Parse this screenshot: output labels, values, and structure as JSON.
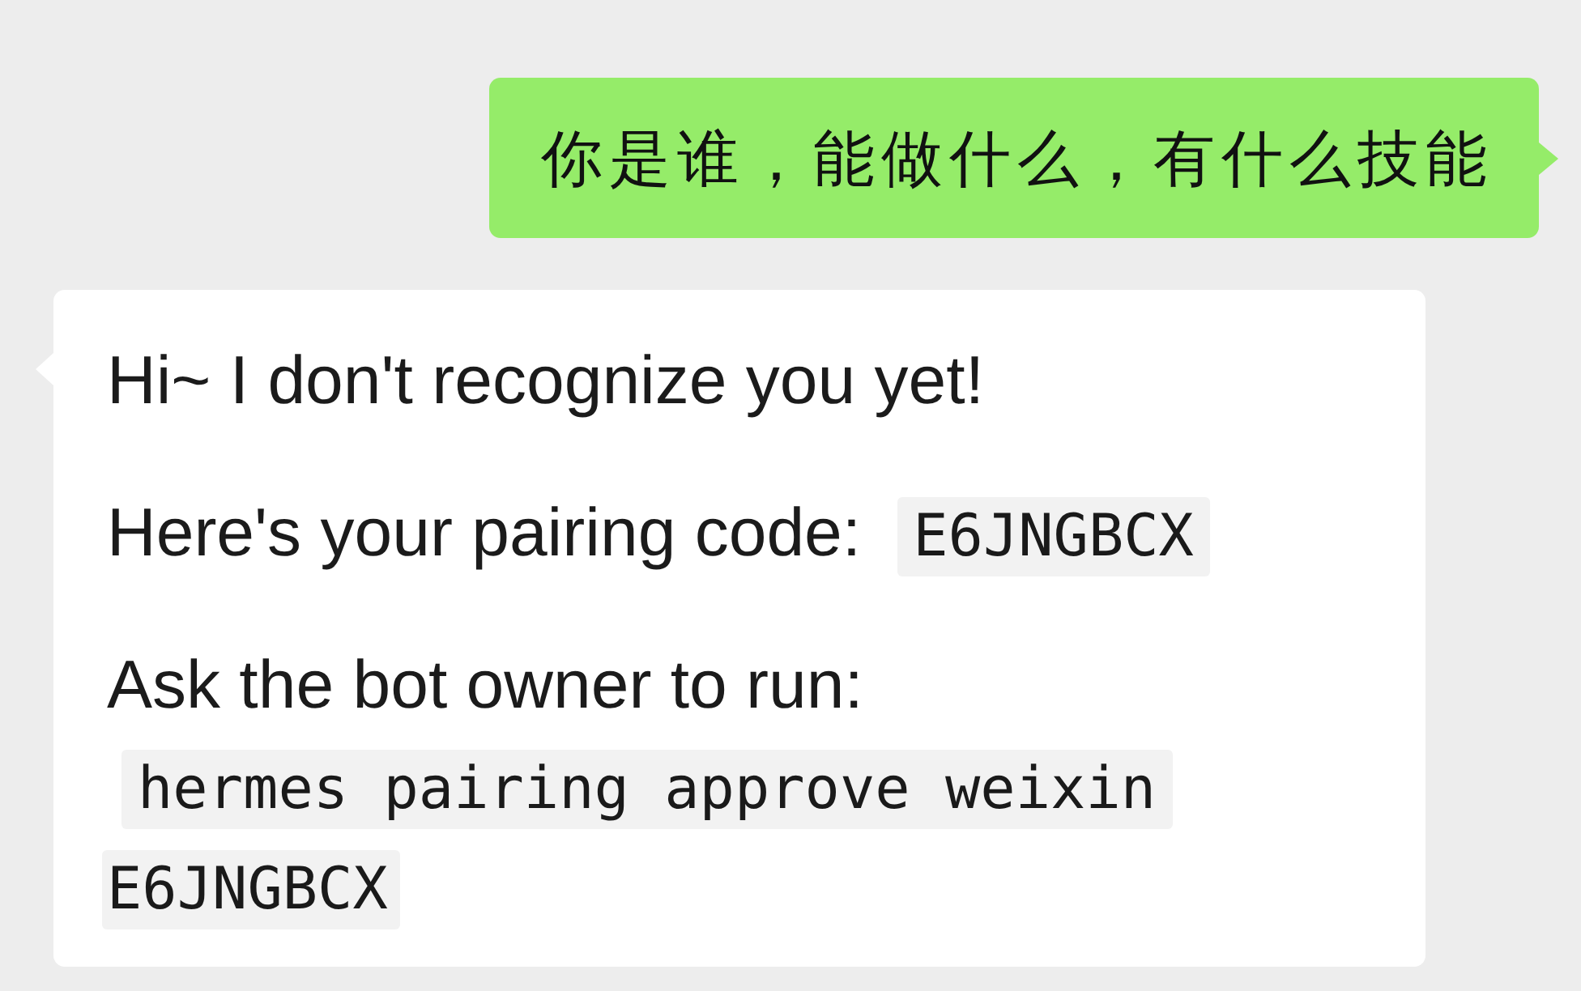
{
  "messages": [
    {
      "kind": "sent",
      "text": "你是谁，能做什么，有什么技能"
    },
    {
      "kind": "received",
      "paragraphs": [
        {
          "kind": "text",
          "text": "Hi~ I don't recognize you yet!"
        },
        {
          "kind": "text_inline_code",
          "text": "Here's your pairing code:",
          "code": "E6JNGBCX"
        },
        {
          "kind": "text_code_below",
          "text": "Ask the bot owner to run:",
          "code_lines": [
            "hermes pairing approve weixin",
            "E6JNGBCX"
          ]
        }
      ]
    }
  ]
}
